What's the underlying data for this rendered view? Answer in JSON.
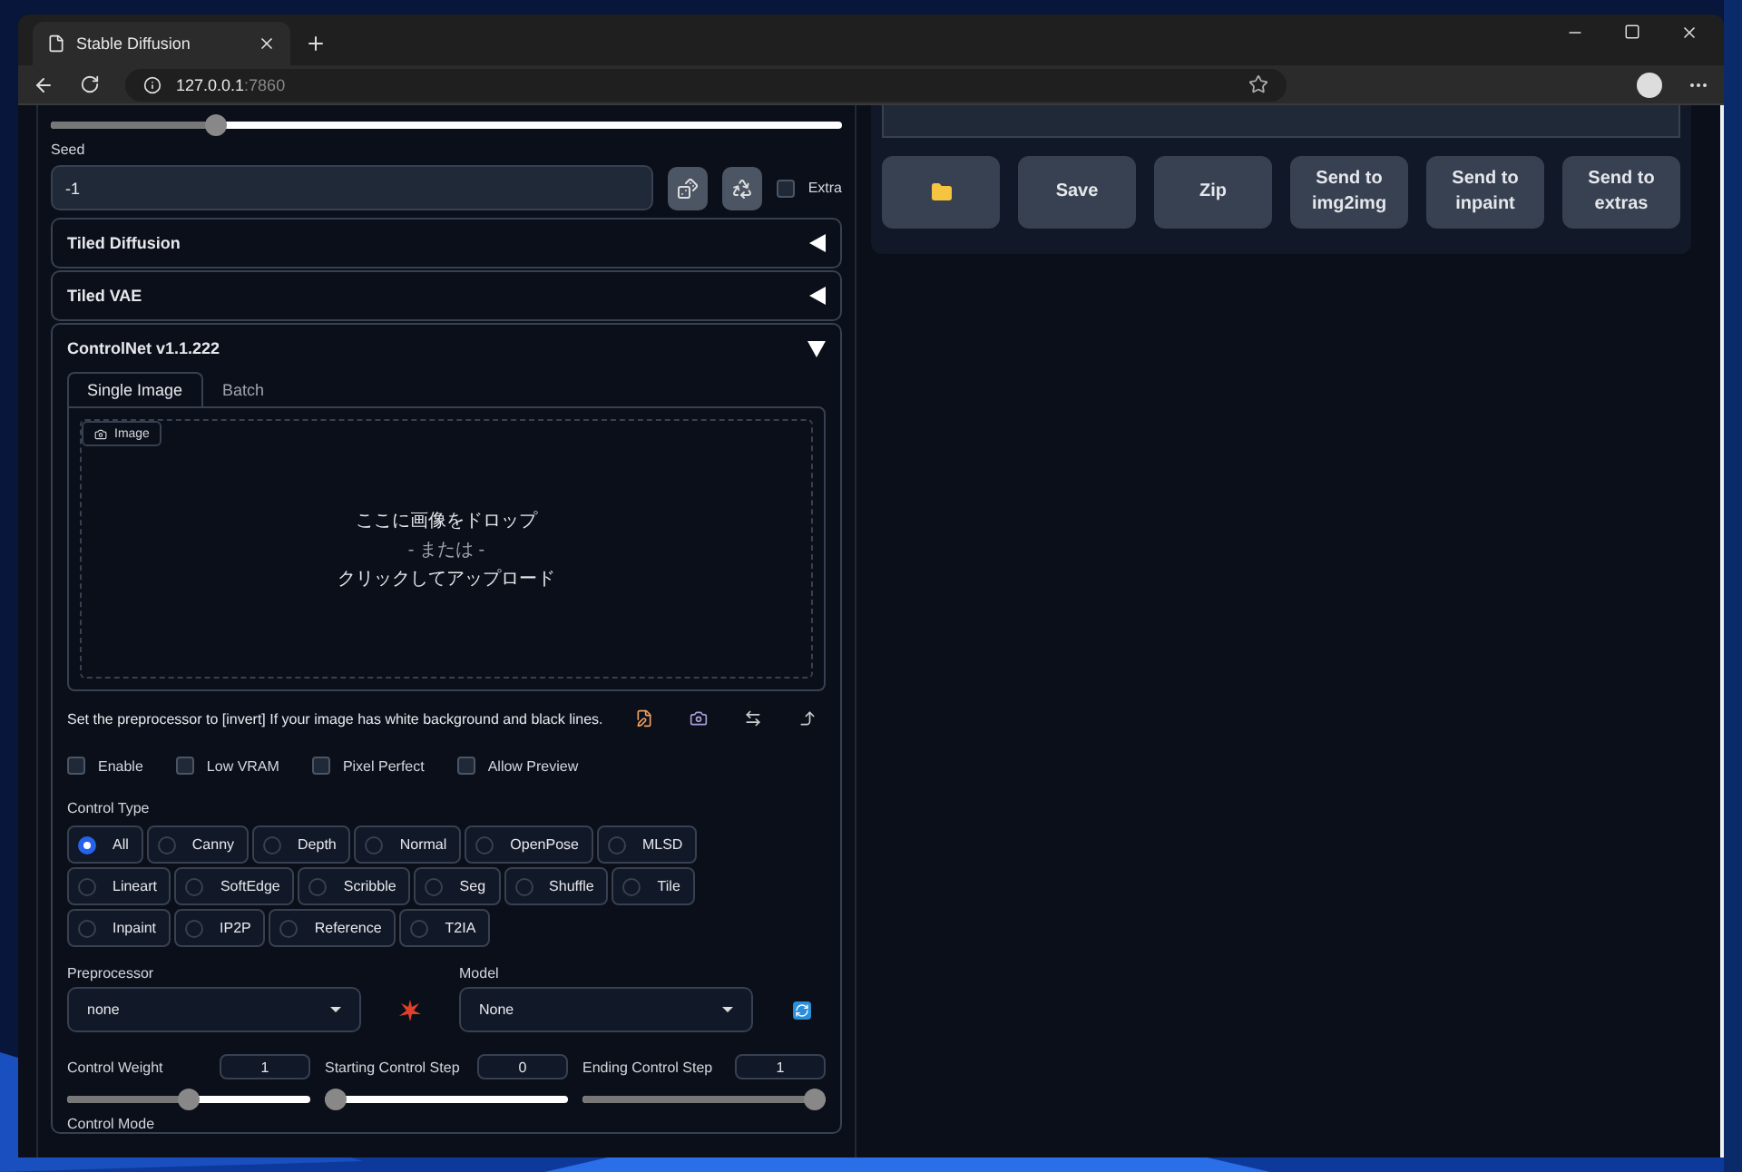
{
  "browser": {
    "tab_title": "Stable Diffusion",
    "url_host": "127.0.0.1",
    "url_port": ":7860"
  },
  "top_slider": {
    "level": 0.2
  },
  "seed": {
    "label": "Seed",
    "value": "-1",
    "extra_label": "Extra",
    "extra_checked": false
  },
  "accordions": [
    {
      "title": "Tiled Diffusion",
      "expanded": false
    },
    {
      "title": "Tiled VAE",
      "expanded": false
    },
    {
      "title": "ControlNet v1.1.222",
      "expanded": true
    }
  ],
  "controlnet": {
    "tabs": [
      {
        "label": "Single Image",
        "selected": true
      },
      {
        "label": "Batch",
        "selected": false
      }
    ],
    "image_label": "Image",
    "drop_lines": [
      "ここに画像をドロップ",
      "- または -",
      "クリックしてアップロード"
    ],
    "hint": "Set the preprocessor to [invert] If your image has white background and black lines.",
    "checkboxes": [
      {
        "label": "Enable",
        "checked": false
      },
      {
        "label": "Low VRAM",
        "checked": false
      },
      {
        "label": "Pixel Perfect",
        "checked": false
      },
      {
        "label": "Allow Preview",
        "checked": false
      }
    ],
    "control_type_label": "Control Type",
    "control_types": [
      {
        "label": "All",
        "selected": true
      },
      {
        "label": "Canny",
        "selected": false
      },
      {
        "label": "Depth",
        "selected": false
      },
      {
        "label": "Normal",
        "selected": false
      },
      {
        "label": "OpenPose",
        "selected": false
      },
      {
        "label": "MLSD",
        "selected": false
      },
      {
        "label": "Lineart",
        "selected": false
      },
      {
        "label": "SoftEdge",
        "selected": false
      },
      {
        "label": "Scribble",
        "selected": false
      },
      {
        "label": "Seg",
        "selected": false
      },
      {
        "label": "Shuffle",
        "selected": false
      },
      {
        "label": "Tile",
        "selected": false
      },
      {
        "label": "Inpaint",
        "selected": false
      },
      {
        "label": "IP2P",
        "selected": false
      },
      {
        "label": "Reference",
        "selected": false
      },
      {
        "label": "T2IA",
        "selected": false
      }
    ],
    "preprocessor": {
      "label": "Preprocessor",
      "value": "none"
    },
    "model": {
      "label": "Model",
      "value": "None"
    },
    "sliders": [
      {
        "label": "Control Weight",
        "value": "1",
        "level": 0.5
      },
      {
        "label": "Starting Control Step",
        "value": "0",
        "level": 0
      },
      {
        "label": "Ending Control Step",
        "value": "1",
        "level": 1
      }
    ],
    "control_mode_label": "Control Mode"
  },
  "output_buttons": [
    {
      "kind": "folder"
    },
    {
      "kind": "text",
      "label": "Save"
    },
    {
      "kind": "text",
      "label": "Zip"
    },
    {
      "kind": "text",
      "label": "Send to img2img"
    },
    {
      "kind": "text",
      "label": "Send to inpaint"
    },
    {
      "kind": "text",
      "label": "Send to extras"
    }
  ]
}
